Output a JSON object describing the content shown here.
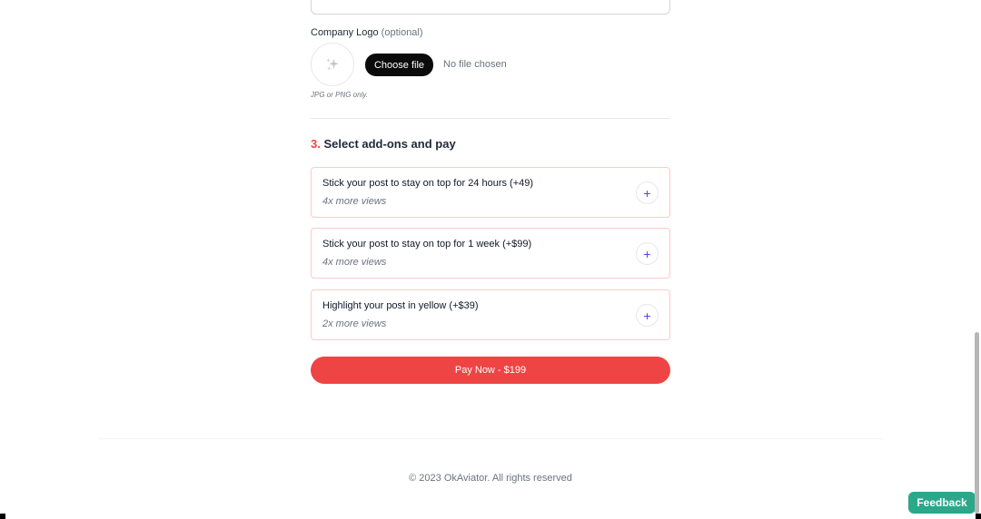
{
  "logo": {
    "label": "Company Logo",
    "optional": "(optional)",
    "choose_button": "Choose file",
    "no_file": "No file chosen",
    "hint": "JPG or PNG only.",
    "preview_icon": "sparkles-icon"
  },
  "section": {
    "number": "3.",
    "title": "Select add-ons and pay"
  },
  "addons": [
    {
      "title": "Stick your post to stay on top for 24 hours (+49)",
      "subtitle": "4x more views",
      "icon": "plus-icon"
    },
    {
      "title": "Stick your post to stay on top for 1 week (+$99)",
      "subtitle": "4x more views",
      "icon": "plus-icon"
    },
    {
      "title": "Highlight your post in yellow (+$39)",
      "subtitle": "2x more views",
      "icon": "plus-icon"
    }
  ],
  "pay_button": "Pay Now - $199",
  "footer": {
    "copyright": "© 2023 OkAviator. All rights reserved"
  },
  "feedback_button": "Feedback",
  "colors": {
    "accent_red": "#ef4444",
    "addon_border": "#fecaca",
    "plus_icon": "#4f46e5",
    "feedback_green": "#2aa889"
  }
}
